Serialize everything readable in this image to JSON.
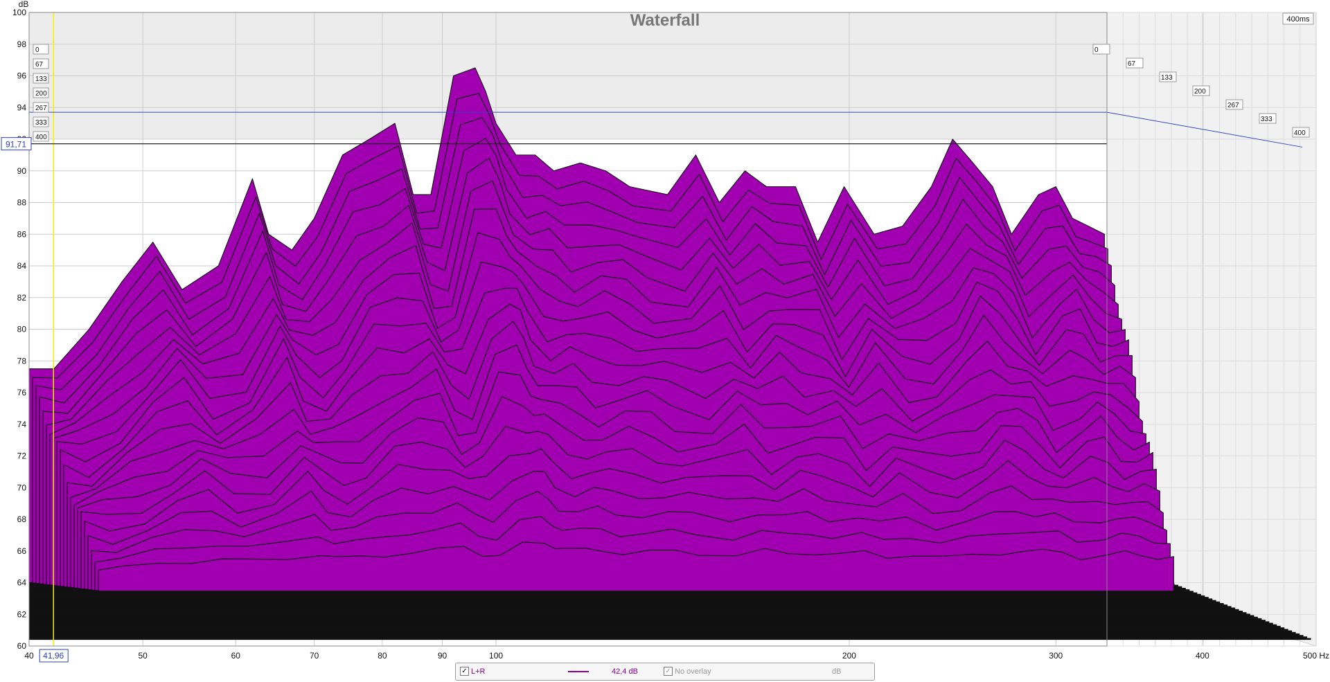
{
  "chart_data": {
    "type": "area",
    "title": "Waterfall",
    "y_unit_label": "dB",
    "x_unit_label": "Hz",
    "x_scale": "log",
    "xlim": [
      40,
      500
    ],
    "ylim": [
      60,
      100
    ],
    "x_ticks": [
      "40",
      "50",
      "60",
      "70",
      "80",
      "90",
      "100",
      "200",
      "300",
      "400",
      "500 Hz"
    ],
    "y_ticks": [
      "100",
      "98",
      "96",
      "94",
      "92",
      "90",
      "88",
      "86",
      "84",
      "82",
      "80",
      "78",
      "76",
      "74",
      "72",
      "70",
      "68",
      "66",
      "64",
      "62",
      "60"
    ],
    "time_slice_labels": [
      "0",
      "67",
      "133",
      "200",
      "267",
      "333",
      "400"
    ],
    "time_span_label": "400ms",
    "cursor": {
      "y_readout": "91,71",
      "x_readout": "41,96"
    },
    "fill_color": "#a000b0",
    "series": [
      {
        "name": "L+R",
        "x": [
          40,
          42,
          45,
          48,
          51,
          54,
          58,
          62,
          64,
          67,
          70,
          74,
          78,
          82,
          85,
          88,
          92,
          96,
          98,
          100,
          104,
          108,
          112,
          118,
          124,
          130,
          140,
          148,
          155,
          163,
          170,
          180,
          188,
          198,
          210,
          222,
          235,
          245,
          255,
          265,
          275,
          290,
          300,
          310,
          320,
          330
        ],
        "y": [
          77.5,
          77.5,
          80,
          83,
          85.5,
          82.5,
          84,
          89.5,
          86,
          85,
          87,
          91,
          92,
          93,
          88.5,
          88.5,
          96,
          96.5,
          95,
          93,
          91,
          91,
          90,
          90.5,
          90,
          89,
          88.5,
          91,
          88,
          90,
          89,
          89,
          85.5,
          89,
          86,
          86.5,
          89,
          92,
          90.5,
          89,
          86,
          88.5,
          89,
          87,
          86.5,
          86
        ]
      }
    ]
  },
  "legend": {
    "series_label": "L+R",
    "series_value": "42,4 dB",
    "overlay_label": "No overlay",
    "overlay_value": "dB"
  }
}
